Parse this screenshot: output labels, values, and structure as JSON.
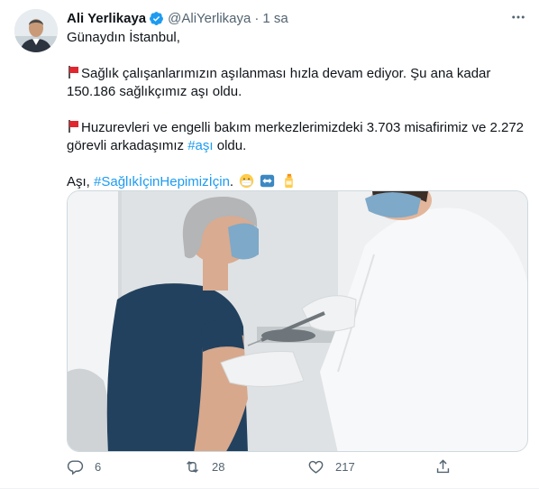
{
  "tweet": {
    "name": "Ali Yerlikaya",
    "handle": "@AliYerlikaya",
    "separator": "·",
    "time": "1 sa",
    "line1": "Günaydın İstanbul,",
    "para2": "Sağlık çalışanlarımızın aşılanması hızla devam ediyor.  Şu ana kadar 150.186 sağlıkçımız aşı oldu.",
    "para3_text": "Huzurevleri ve engelli bakım merkezlerimizdeki 3.703 misafirimiz ve 2.272 görevli arkadaşımız ",
    "para3_hashtag": "#aşı",
    "para3_end": " oldu.",
    "para4_text": "Aşı, ",
    "para4_hashtag": "#SağlıkİçinHepimizİçin",
    "para4_end": ".",
    "emojis": [
      "medical-mask-emoji",
      "left-right-arrow-emoji",
      "lotion-bottle-emoji"
    ],
    "flag_emoji": "triangular-red-flag-emoji"
  },
  "actions": {
    "reply_count": "6",
    "retweet_count": "28",
    "like_count": "217"
  },
  "colors": {
    "accent": "#1d9bf0",
    "text": "#0f1419",
    "secondary": "#536471",
    "flag": "#e0262e"
  },
  "media": {
    "description_icon": "vaccination-photo"
  }
}
